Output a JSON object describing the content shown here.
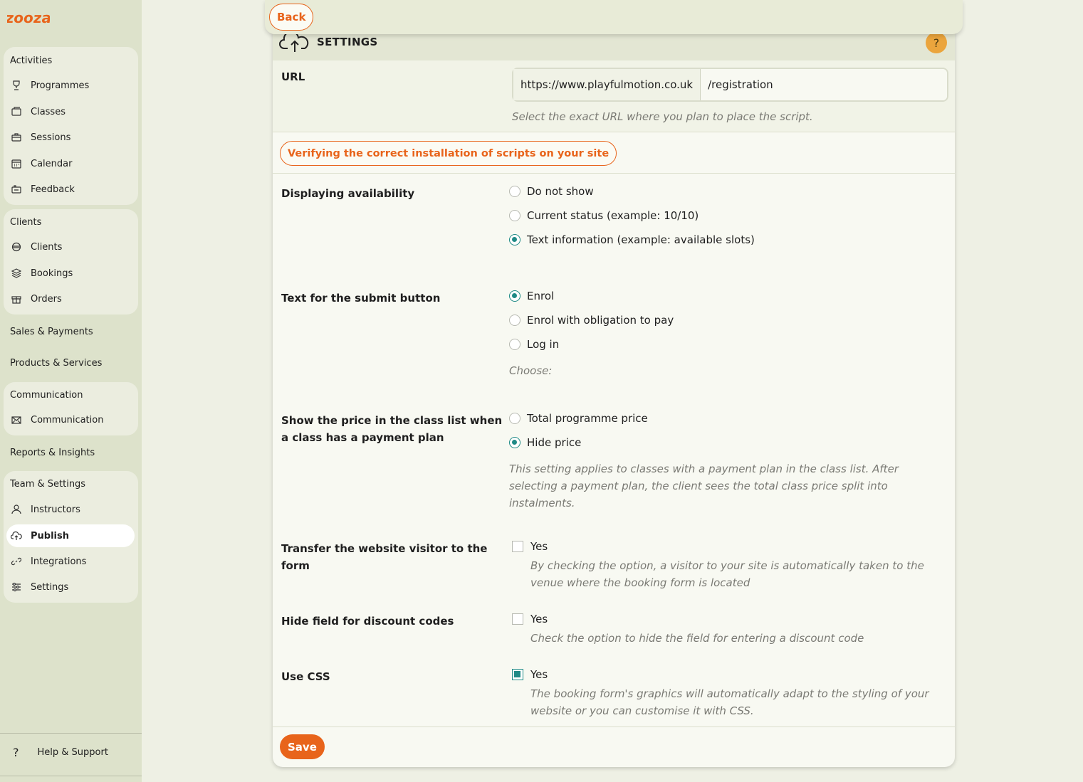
{
  "app": {
    "brand": "Zooza"
  },
  "sidebar": {
    "groups": [
      {
        "heading": "Activities",
        "items": [
          {
            "label": "Programmes",
            "icon": "trophy-icon"
          },
          {
            "label": "Classes",
            "icon": "folder-icon"
          },
          {
            "label": "Sessions",
            "icon": "briefcase-icon"
          },
          {
            "label": "Calendar",
            "icon": "calendar-icon"
          },
          {
            "label": "Feedback",
            "icon": "feedback-icon"
          }
        ]
      },
      {
        "heading": "Clients",
        "items": [
          {
            "label": "Clients",
            "icon": "users-icon"
          },
          {
            "label": "Bookings",
            "icon": "layers-icon"
          },
          {
            "label": "Orders",
            "icon": "gift-icon"
          }
        ]
      },
      {
        "heading": "Sales & Payments",
        "items": []
      },
      {
        "heading": "Products & Services",
        "items": []
      },
      {
        "heading": "Communication",
        "items": [
          {
            "label": "Communication",
            "icon": "mail-icon"
          }
        ]
      },
      {
        "heading": "Reports & Insights",
        "items": []
      },
      {
        "heading": "Team & Settings",
        "items": [
          {
            "label": "Instructors",
            "icon": "user-icon"
          },
          {
            "label": "Publish",
            "icon": "cloud-upload-icon",
            "active": true
          },
          {
            "label": "Integrations",
            "icon": "link-icon"
          },
          {
            "label": "Settings",
            "icon": "sliders-icon"
          }
        ]
      }
    ],
    "help_label": "Help & Support"
  },
  "topbar": {
    "back_label": "Back"
  },
  "panel": {
    "title": "SETTINGS",
    "help_symbol": "?",
    "url": {
      "label": "URL",
      "prefix": "https://www.playfulmotion.co.uk",
      "value": "/registration",
      "hint": "Select the exact URL where you plan to place the script."
    },
    "verify_label": "Verifying the correct installation of scripts on your site",
    "availability": {
      "label": "Displaying availability",
      "options": [
        "Do not show",
        "Current status (example: 10/10)",
        "Text information (example: available slots)"
      ],
      "selected": 2
    },
    "submit_text": {
      "label": "Text for the submit button",
      "options": [
        "Enrol",
        "Enrol with obligation to pay",
        "Log in"
      ],
      "selected": 0,
      "hint": "Choose:"
    },
    "price": {
      "label_line1": "Show the price in the class list when",
      "label_line2": "a class has a payment plan",
      "options": [
        "Total programme price",
        "Hide price"
      ],
      "selected": 1,
      "hint_line1": "This setting applies to classes with a payment plan in the class list. After",
      "hint_line2": "selecting a payment plan, the client sees the total class price split into",
      "hint_line3": "instalments."
    },
    "transfer": {
      "label_line1": "Transfer the website visitor to the",
      "label_line2": "form",
      "option": "Yes",
      "checked": false,
      "hint_line1": "By checking the option, a visitor to your site is automatically taken to the",
      "hint_line2": "venue where the booking form is located"
    },
    "discount": {
      "label": "Hide field for discount codes",
      "option": "Yes",
      "checked": false,
      "hint": "Check the option to hide the field for entering a discount code"
    },
    "css": {
      "label": "Use CSS",
      "option": "Yes",
      "checked": true,
      "hint_line1": "The booking form's graphics will automatically adapt to the styling of your",
      "hint_line2": "website or you can customise it with CSS."
    },
    "save_label": "Save"
  },
  "colors": {
    "accent": "#e8641b",
    "radio": "#1f8a86",
    "sidebar_bg": "#dde2cb"
  }
}
